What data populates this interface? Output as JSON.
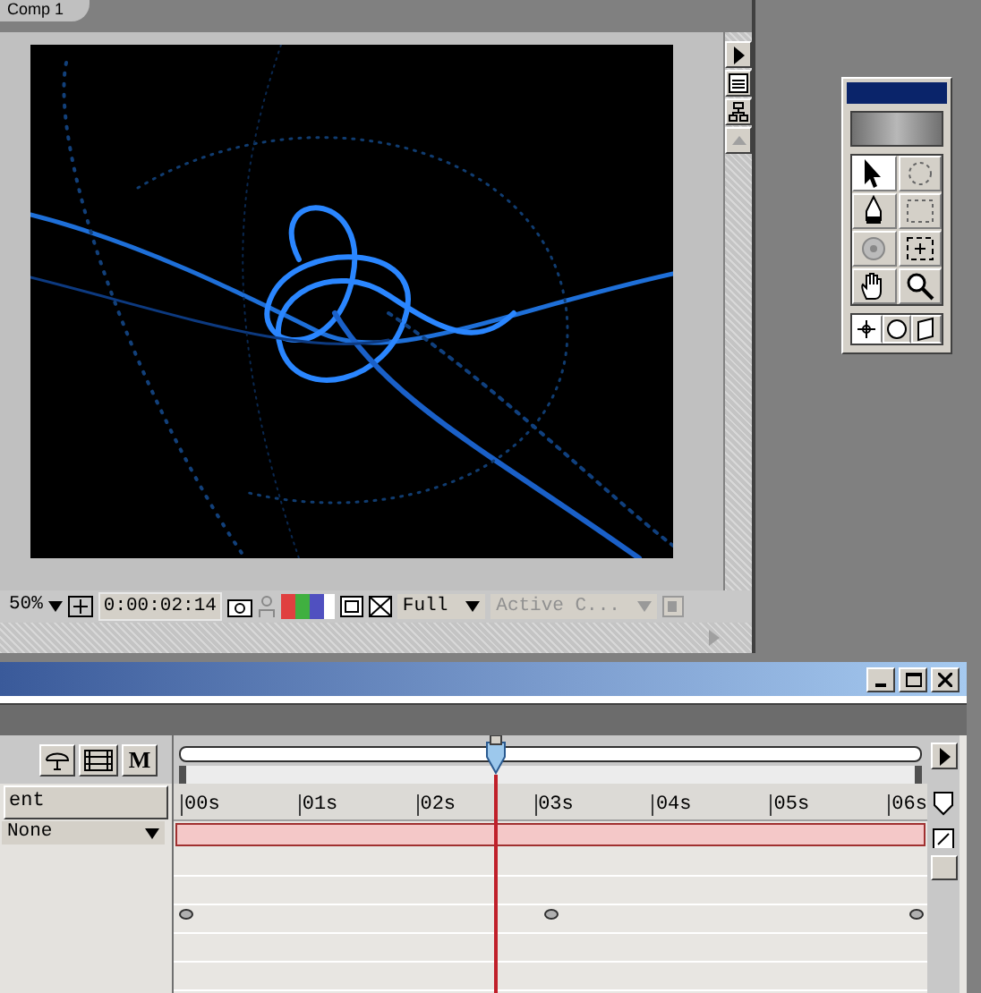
{
  "comp_window": {
    "tab": "Comp 1",
    "zoom": "50%",
    "timecode": "0:00:02:14",
    "resolution": "Full",
    "view": "Active C..."
  },
  "tools": [
    {
      "kind": "selection",
      "selected": true
    },
    {
      "kind": "rotation",
      "selected": false
    },
    {
      "kind": "pen",
      "selected": false
    },
    {
      "kind": "mask",
      "selected": false
    },
    {
      "kind": "orbit",
      "selected": false
    },
    {
      "kind": "pan-behind",
      "selected": false
    },
    {
      "kind": "hand",
      "selected": false
    },
    {
      "kind": "zoom",
      "selected": false
    }
  ],
  "axis_modes": [
    {
      "kind": "local",
      "selected": true
    },
    {
      "kind": "world",
      "selected": false
    },
    {
      "kind": "view",
      "selected": false
    }
  ],
  "timeline": {
    "column_header": "ent",
    "parent": "None",
    "motion_blur": "M",
    "time_labels": [
      "00s",
      "01s",
      "02s",
      "03s",
      "04s",
      "05s",
      "06s"
    ]
  }
}
